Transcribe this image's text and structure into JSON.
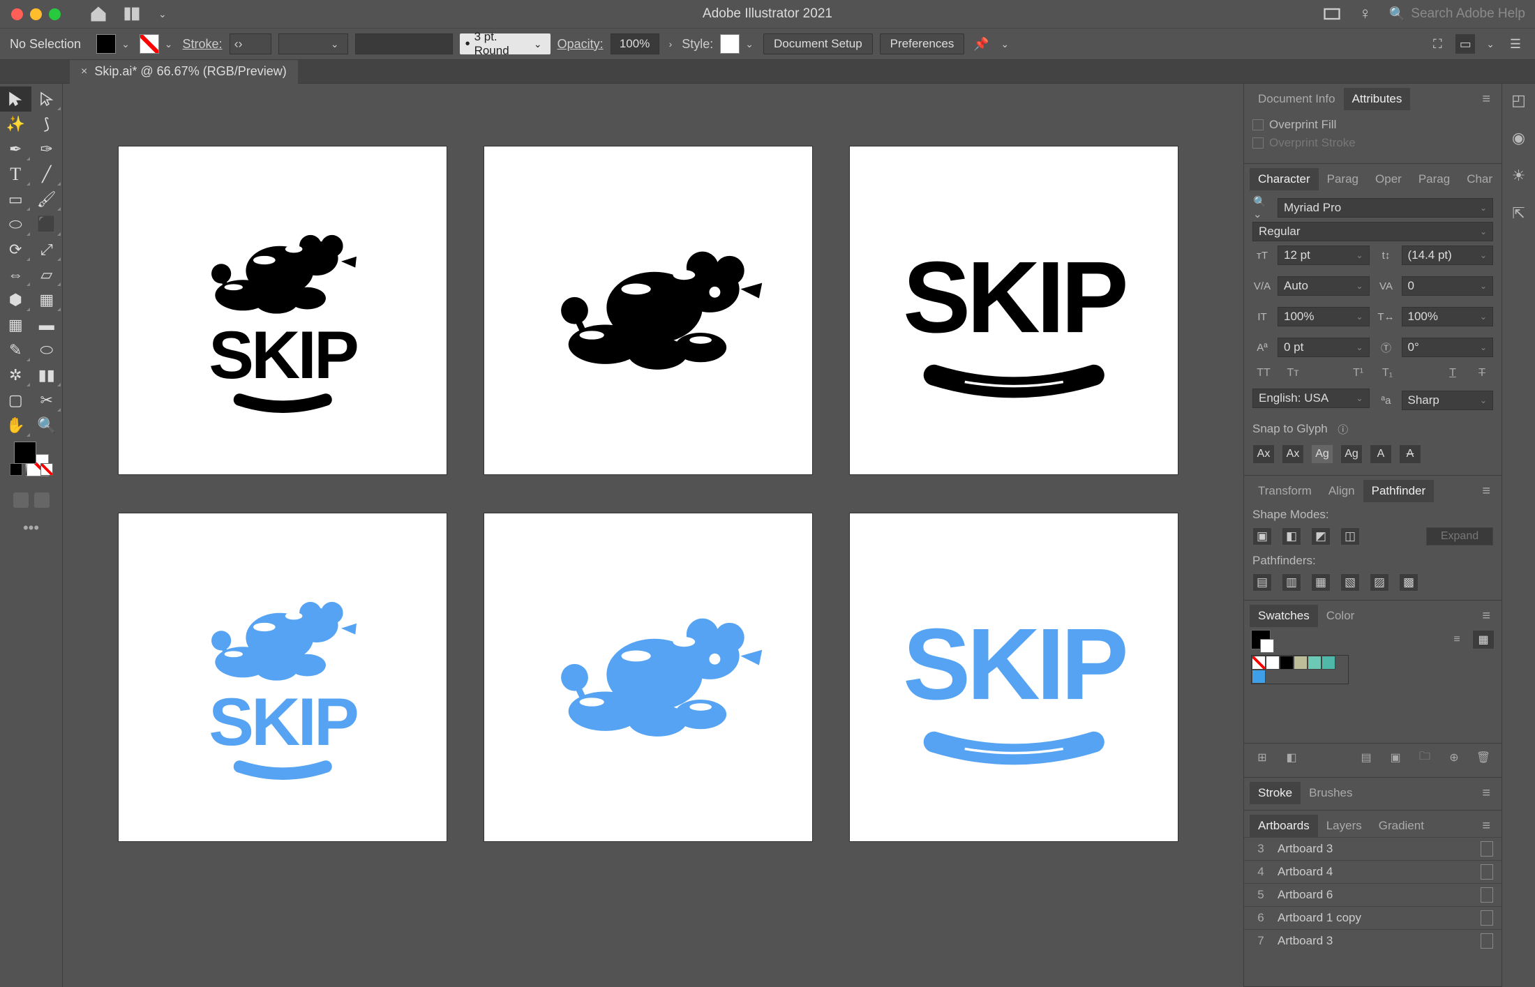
{
  "app_title": "Adobe Illustrator 2021",
  "search_placeholder": "Search Adobe Help",
  "control_bar": {
    "selection": "No Selection",
    "stroke_label": "Stroke:",
    "stroke_profile": "3 pt. Round",
    "opacity_label": "Opacity:",
    "opacity_value": "100%",
    "style_label": "Style:",
    "doc_setup": "Document Setup",
    "preferences": "Preferences"
  },
  "doc_tab": "Skip.ai* @ 66.67% (RGB/Preview)",
  "artboard_text": "SKIP",
  "colors": {
    "logo_black": "#000000",
    "logo_blue": "#55a3f2",
    "artboard_bg": "#ffffff"
  },
  "panels": {
    "doc_info": "Document Info",
    "attributes": "Attributes",
    "overprint_fill": "Overprint Fill",
    "overprint_stroke": "Overprint Stroke",
    "character_tabs": [
      "Character",
      "Parag",
      "Oper",
      "Parag",
      "Char"
    ],
    "font_family": "Myriad Pro",
    "font_style": "Regular",
    "font_size": "12 pt",
    "leading": "(14.4 pt)",
    "kerning": "Auto",
    "tracking": "0",
    "vscale": "100%",
    "hscale": "100%",
    "baseline": "0 pt",
    "rotation": "0°",
    "language": "English: USA",
    "antialias": "Sharp",
    "snap_glyph": "Snap to Glyph",
    "align_tabs": [
      "Transform",
      "Align",
      "Pathfinder"
    ],
    "shape_modes": "Shape Modes:",
    "pathfinders": "Pathfinders:",
    "expand": "Expand",
    "swatches_tabs": [
      "Swatches",
      "Color"
    ],
    "stroke_tabs": [
      "Stroke",
      "Brushes"
    ],
    "artboards_tabs": [
      "Artboards",
      "Layers",
      "Gradient"
    ],
    "artboards": [
      {
        "n": "3",
        "name": "Artboard 3"
      },
      {
        "n": "4",
        "name": "Artboard 4"
      },
      {
        "n": "5",
        "name": "Artboard 6"
      },
      {
        "n": "6",
        "name": "Artboard 1 copy"
      },
      {
        "n": "7",
        "name": "Artboard 3"
      }
    ]
  }
}
